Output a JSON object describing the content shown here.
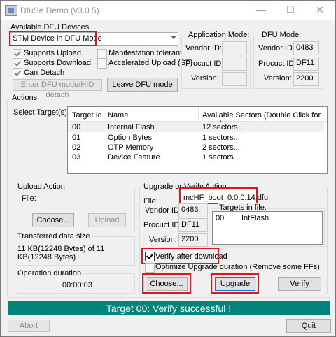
{
  "window": {
    "title": "DfuSe Demo (v3.0.5)",
    "minimize": "—",
    "maximize": "☐",
    "close": "✕"
  },
  "dfu_devices": {
    "group_label": "Available DFU Devices",
    "selected_device": "STM Device in DFU Mode",
    "checkboxes": [
      {
        "label": "Supports Upload",
        "checked": true
      },
      {
        "label": "Supports Download",
        "checked": true
      },
      {
        "label": "Can Detach",
        "checked": true
      },
      {
        "label": "Manifestation tolerant",
        "checked": false
      },
      {
        "label": "Accelerated Upload (ST)",
        "checked": false
      }
    ],
    "enter_dfu_button": "Enter DFU mode/HID detach",
    "leave_dfu_button": "Leave DFU mode"
  },
  "application_mode": {
    "group_label": "Application Mode:",
    "vendor_label": "Vendor ID:",
    "product_label": "Procuct ID:",
    "version_label": "Version:",
    "vendor": "",
    "product": "",
    "version": ""
  },
  "dfu_mode": {
    "group_label": "DFU Mode:",
    "vendor_label": "Vendor ID:",
    "product_label": "Procuct ID:",
    "version_label": "Version:",
    "vendor": "0483",
    "product": "DF11",
    "version": "2200"
  },
  "actions": {
    "group_label": "Actions",
    "select_targets_label": "Select Target(s):",
    "columns": [
      "Target Id",
      "Name",
      "Available Sectors (Double Click for more)"
    ],
    "rows": [
      [
        "00",
        "Internal Flash",
        "12 sectors..."
      ],
      [
        "01",
        "Option Bytes",
        "1 sectors..."
      ],
      [
        "02",
        "OTP Memory",
        "2 sectors..."
      ],
      [
        "03",
        "Device Feature",
        "1 sectors..."
      ]
    ]
  },
  "upload_action": {
    "group_label": "Upload Action",
    "file_label": "File:",
    "choose_button": "Choose...",
    "upload_button": "Upload"
  },
  "transferred": {
    "group_label": "Transferred data size",
    "value": "11 KB(12248 Bytes) of 11 KB(12248 Bytes)"
  },
  "operation": {
    "group_label": "Operation duration",
    "value": "00:00:03"
  },
  "upgrade_action": {
    "group_label": "Upgrade or Verify Action",
    "file_label": "File:",
    "file_name": "mcHF_boot_0.0.0.14.dfu",
    "vendor_label": "Vendor ID:",
    "vendor": "0483",
    "product_label": "Procuct ID:",
    "product": "DF11",
    "version_label": "Version:",
    "version": "2200",
    "targets_label": "Targets in file:",
    "target_id": "00",
    "target_name": "IntFlash",
    "verify_after_download": "Verify after download",
    "optimize_label": "Optimize Upgrade duration (Remove some FFs)",
    "choose_button": "Choose...",
    "upgrade_button": "Upgrade",
    "verify_button": "Verify"
  },
  "status": {
    "text": "Target 00: Verify successful !",
    "color": "#00847c"
  },
  "footer": {
    "abort_button": "Abort",
    "quit_button": "Quit"
  }
}
